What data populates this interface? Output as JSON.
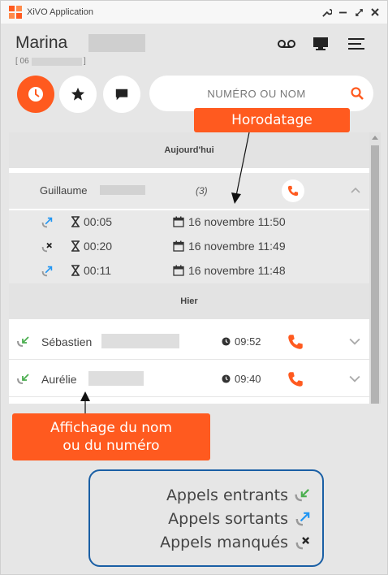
{
  "window": {
    "title": "XiVO Application"
  },
  "user": {
    "name": "Marina",
    "number_prefix": "[ 06",
    "number_suffix": "]"
  },
  "search": {
    "placeholder": "NUMÉRO OU NOM"
  },
  "history": {
    "today_label": "Aujourd'hui",
    "yesterday_label": "Hier",
    "group": {
      "name": "Guillaume",
      "count": "(3)",
      "details": [
        {
          "type": "outgoing",
          "duration": "00:05",
          "date": "16 novembre 11:50"
        },
        {
          "type": "missed",
          "duration": "00:20",
          "date": "16 novembre 11:49"
        },
        {
          "type": "outgoing",
          "duration": "00:11",
          "date": "16 novembre 11:48"
        }
      ]
    },
    "entries": [
      {
        "type": "incoming",
        "name": "Sébastien",
        "time": "09:52"
      },
      {
        "type": "incoming",
        "name": "Aurélie",
        "time": "09:40"
      }
    ]
  },
  "annotations": {
    "timestamp_callout": "Horodatage",
    "name_callout_line1": "Affichage du nom",
    "name_callout_line2": "ou du numéro"
  },
  "legend": {
    "incoming": "Appels entrants",
    "outgoing": "Appels sortants",
    "missed": "Appels manqués"
  },
  "colors": {
    "accent": "#ff5a1f",
    "incoming": "#4caf50",
    "outgoing": "#2196f3",
    "missed": "#333333",
    "legend_border": "#1a5fa5"
  }
}
